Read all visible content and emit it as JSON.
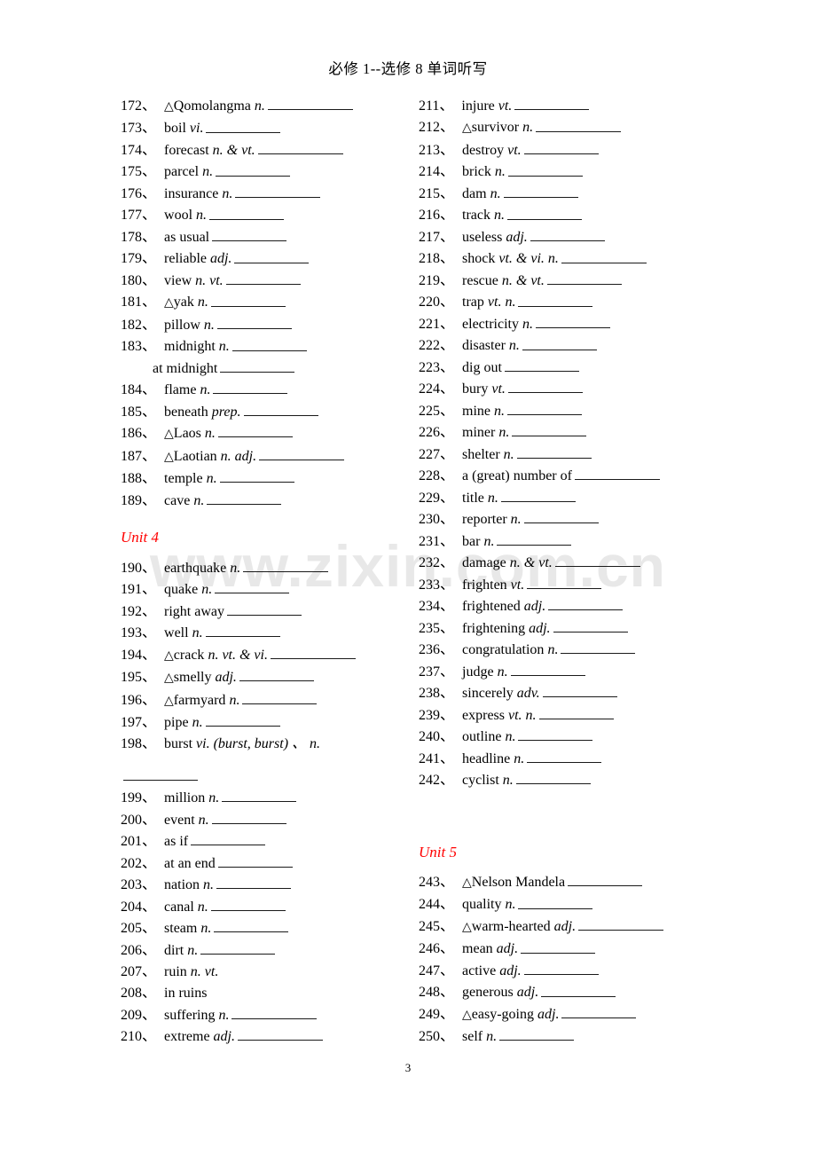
{
  "document": {
    "title": "必修 1--选修 8 单词听写",
    "page_number": "3",
    "watermark": "www.zixin.com.cn"
  },
  "glyphs": {
    "triangle": "△",
    "ideographic_comma": "、"
  },
  "colors": {
    "unit_heading": "#ff0000",
    "text": "#000000",
    "blank_rule": "#1a1a1a",
    "watermark": "#e8e8e8"
  },
  "left_column": {
    "entries": [
      {
        "num": "172",
        "tri": true,
        "term": "Qomolangma",
        "pos": "n.",
        "blank": "b-l"
      },
      {
        "num": "173",
        "tri": false,
        "term": "boil",
        "pos": "vi.",
        "blank": "b-m"
      },
      {
        "num": "174",
        "tri": false,
        "term": "forecast",
        "pos": "n. & vt.",
        "blank": "b-l"
      },
      {
        "num": "175",
        "tri": false,
        "term": "parcel",
        "pos": "n.",
        "blank": "b-m"
      },
      {
        "num": "176",
        "tri": false,
        "term": "insurance",
        "pos": "n.",
        "blank": "b-l"
      },
      {
        "num": "177",
        "tri": false,
        "term": "wool",
        "pos": "n.",
        "blank": "b-m"
      },
      {
        "num": "178",
        "tri": false,
        "term": "as usual",
        "pos": "",
        "blank": "b-m"
      },
      {
        "num": "179",
        "tri": false,
        "term": "reliable",
        "pos": "adj.",
        "blank": "b-m"
      },
      {
        "num": "180",
        "tri": false,
        "term": "view",
        "pos": "n.   vt.",
        "blank": "b-m"
      },
      {
        "num": "181",
        "tri": true,
        "term": "yak",
        "pos": "n.",
        "blank": "b-m"
      },
      {
        "num": "182",
        "tri": false,
        "term": "pillow",
        "pos": "n.",
        "blank": "b-m"
      },
      {
        "num": "183",
        "tri": false,
        "term": "midnight",
        "pos": "n.",
        "blank": "b-m",
        "sub": {
          "term": "at midnight",
          "blank": "b-m"
        }
      },
      {
        "num": "184",
        "tri": false,
        "term": "flame",
        "pos": "n.",
        "blank": "b-m"
      },
      {
        "num": "185",
        "tri": false,
        "term": "beneath",
        "pos": "prep.",
        "blank": "b-m"
      },
      {
        "num": "186",
        "tri": true,
        "term": "Laos",
        "pos": "n.",
        "blank": "b-m"
      },
      {
        "num": "187",
        "tri": true,
        "term": "Laotian",
        "pos": "n.    adj.",
        "blank": "b-l"
      },
      {
        "num": "188",
        "tri": false,
        "term": "temple",
        "pos": "n.",
        "blank": "b-m"
      },
      {
        "num": "189",
        "tri": false,
        "term": "cave",
        "pos": "n.",
        "blank": "b-m"
      }
    ],
    "unit_heading": "Unit 4",
    "unit4_entries": [
      {
        "num": "190",
        "tri": false,
        "term": "earthquake",
        "pos": "n.",
        "blank": "b-l"
      },
      {
        "num": "191",
        "tri": false,
        "term": "quake",
        "pos": "n.",
        "blank": "b-m"
      },
      {
        "num": "192",
        "tri": false,
        "term": "right away",
        "pos": "",
        "blank": "b-m"
      },
      {
        "num": "193",
        "tri": false,
        "term": "well",
        "pos": "n.",
        "blank": "b-m"
      },
      {
        "num": "194",
        "tri": true,
        "term": "crack",
        "pos": "n.    vt. & vi.",
        "blank": "b-l"
      },
      {
        "num": "195",
        "tri": true,
        "term": "smelly",
        "pos": "adj.",
        "blank": "b-m"
      },
      {
        "num": "196",
        "tri": true,
        "term": "farmyard",
        "pos": "n.",
        "blank": "b-m"
      },
      {
        "num": "197",
        "tri": false,
        "term": "pipe",
        "pos": "n.",
        "blank": "b-m"
      },
      {
        "num": "198",
        "tri": false,
        "term": "burst",
        "pos": "vi. (burst, burst)  、      n.",
        "wrap": true,
        "blank": "b-m"
      },
      {
        "num": "199",
        "tri": false,
        "term": "million",
        "pos": "n.",
        "blank": "b-m"
      },
      {
        "num": "200",
        "tri": false,
        "term": "event",
        "pos": "n.",
        "blank": "b-m"
      },
      {
        "num": "201",
        "tri": false,
        "term": "as if",
        "pos": "",
        "blank": "b-m"
      },
      {
        "num": "202",
        "tri": false,
        "term": "at an end",
        "pos": "",
        "blank": "b-m"
      },
      {
        "num": "203",
        "tri": false,
        "term": "nation",
        "pos": "n.",
        "blank": "b-m"
      },
      {
        "num": "204",
        "tri": false,
        "term": "canal",
        "pos": "n.",
        "blank": "b-m"
      },
      {
        "num": "205",
        "tri": false,
        "term": "steam",
        "pos": "n.",
        "blank": "b-m"
      },
      {
        "num": "206",
        "tri": false,
        "term": "dirt",
        "pos": "n.",
        "blank": "b-m"
      },
      {
        "num": "207",
        "tri": false,
        "term": "ruin",
        "pos": "n.      vt.",
        "blank": ""
      },
      {
        "num": "208",
        "tri": false,
        "term": "in ruins",
        "pos": "",
        "blank": ""
      },
      {
        "num": "209",
        "tri": false,
        "term": "suffering",
        "pos": "n.",
        "blank": "b-l"
      },
      {
        "num": "210",
        "tri": false,
        "term": "extreme",
        "pos": "adj.",
        "blank": "b-l"
      }
    ]
  },
  "right_column": {
    "entries": [
      {
        "num": "211",
        "tri": false,
        "term": "injure",
        "pos": "vt.",
        "blank": "b-m",
        "gap": true
      },
      {
        "num": "212",
        "tri": true,
        "term": "survivor",
        "pos": "n.",
        "blank": "b-l"
      },
      {
        "num": "213",
        "tri": false,
        "term": "destroy",
        "pos": "vt.",
        "blank": "b-m",
        "gap": true
      },
      {
        "num": "214",
        "tri": false,
        "term": "brick",
        "pos": "n.",
        "blank": "b-m"
      },
      {
        "num": "215",
        "tri": false,
        "term": "dam",
        "pos": "n.",
        "blank": "b-m"
      },
      {
        "num": "216",
        "tri": false,
        "term": "track",
        "pos": "n.",
        "blank": "b-m"
      },
      {
        "num": "217",
        "tri": false,
        "term": "useless",
        "pos": "adj.",
        "blank": "b-m"
      },
      {
        "num": "218",
        "tri": false,
        "term": "shock",
        "pos": "vt. & vi.     n.",
        "blank": "b-l",
        "gap": true
      },
      {
        "num": "219",
        "tri": false,
        "term": "rescue",
        "pos": "n. & vt.",
        "blank": "b-m"
      },
      {
        "num": "220",
        "tri": false,
        "term": "trap",
        "pos": "vt. n.",
        "blank": "b-m"
      },
      {
        "num": "221",
        "tri": false,
        "term": "electricity",
        "pos": "n.",
        "blank": "b-m"
      },
      {
        "num": "222",
        "tri": false,
        "term": "disaster",
        "pos": "n.",
        "blank": "b-m"
      },
      {
        "num": "223",
        "tri": false,
        "term": "dig out",
        "pos": "",
        "blank": "b-m"
      },
      {
        "num": "224",
        "tri": false,
        "term": "bury",
        "pos": "vt.",
        "blank": "b-m"
      },
      {
        "num": "225",
        "tri": false,
        "term": "mine",
        "pos": "n.",
        "blank": "b-m"
      },
      {
        "num": "226",
        "tri": false,
        "term": "miner",
        "pos": "n.",
        "blank": "b-m"
      },
      {
        "num": "227",
        "tri": false,
        "term": "shelter",
        "pos": "n.",
        "blank": "b-m"
      },
      {
        "num": "228",
        "tri": false,
        "term": "a (great) number of",
        "pos": "",
        "blank": "b-l"
      },
      {
        "num": "229",
        "tri": false,
        "term": "title",
        "pos": "n.",
        "blank": "b-m"
      },
      {
        "num": "230",
        "tri": false,
        "term": "reporter",
        "pos": "n.",
        "blank": "b-m"
      },
      {
        "num": "231",
        "tri": false,
        "term": "bar",
        "pos": "n.",
        "blank": "b-m"
      },
      {
        "num": "232",
        "tri": false,
        "term": "damage",
        "pos": "n. & vt.",
        "blank": "b-l"
      },
      {
        "num": "233",
        "tri": false,
        "term": "frighten",
        "pos": "vt.",
        "blank": "b-m"
      },
      {
        "num": "234",
        "tri": false,
        "term": "frightened",
        "pos": "adj.",
        "blank": "b-m"
      },
      {
        "num": "235",
        "tri": false,
        "term": "frightening",
        "pos": "adj.",
        "blank": "b-m"
      },
      {
        "num": "236",
        "tri": false,
        "term": "congratulation",
        "pos": "n.",
        "blank": "b-m"
      },
      {
        "num": "237",
        "tri": false,
        "term": "judge",
        "pos": "n.",
        "blank": "b-m"
      },
      {
        "num": "238",
        "tri": false,
        "term": "sincerely",
        "pos": "adv.",
        "blank": "b-m"
      },
      {
        "num": "239",
        "tri": false,
        "term": "express",
        "pos": "vt.    n.",
        "blank": "b-m",
        "gap": true
      },
      {
        "num": "240",
        "tri": false,
        "term": "outline",
        "pos": "n.",
        "blank": "b-m"
      },
      {
        "num": "241",
        "tri": false,
        "term": "headline",
        "pos": "n.",
        "blank": "b-m"
      },
      {
        "num": "242",
        "tri": false,
        "term": "cyclist",
        "pos": "n.",
        "blank": "b-m"
      }
    ],
    "unit_heading": "Unit 5",
    "unit5_entries": [
      {
        "num": "243",
        "tri": true,
        "term": "Nelson Mandela",
        "pos": "",
        "blank": "b-m"
      },
      {
        "num": "244",
        "tri": false,
        "term": "quality",
        "pos": "n.",
        "blank": "b-m"
      },
      {
        "num": "245",
        "tri": true,
        "term": "warm-hearted",
        "pos": "adj.",
        "blank": "b-l"
      },
      {
        "num": "246",
        "tri": false,
        "term": "mean",
        "pos": "adj.",
        "blank": "b-m"
      },
      {
        "num": "247",
        "tri": false,
        "term": "active",
        "pos": "adj.",
        "blank": "b-m"
      },
      {
        "num": "248",
        "tri": false,
        "term": "generous",
        "pos": "adj.",
        "blank": "b-m"
      },
      {
        "num": "249",
        "tri": true,
        "term": "easy-going",
        "pos": "adj.",
        "blank": "b-m"
      },
      {
        "num": "250",
        "tri": false,
        "term": "self",
        "pos": "n.",
        "blank": "b-m",
        "gap": true
      }
    ]
  }
}
